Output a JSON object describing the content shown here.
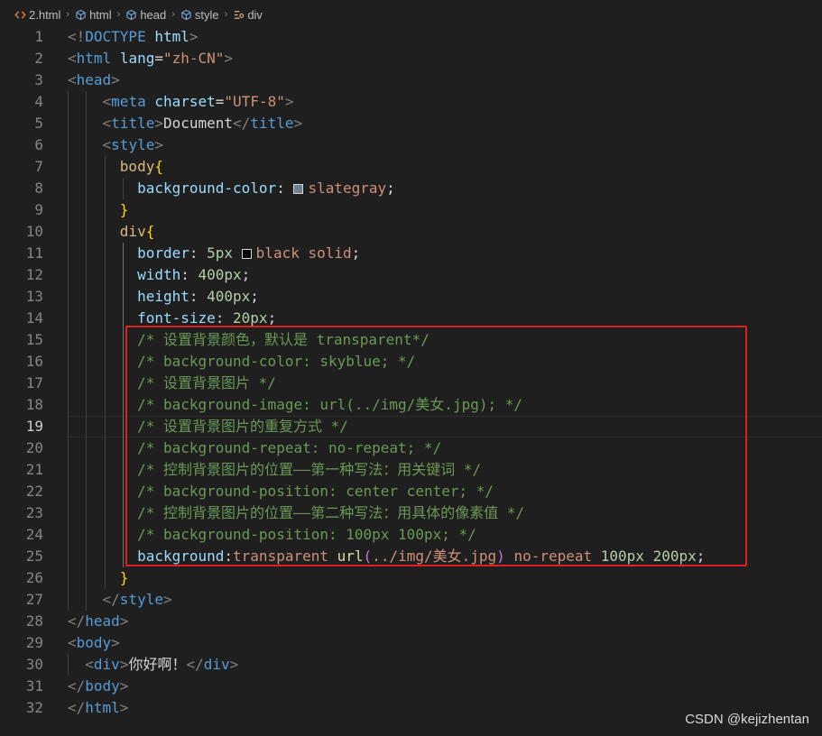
{
  "breadcrumb": {
    "items": [
      {
        "label": "2.html",
        "icon": "html-file-icon"
      },
      {
        "label": "html",
        "icon": "element-icon"
      },
      {
        "label": "head",
        "icon": "element-icon"
      },
      {
        "label": "style",
        "icon": "element-icon"
      },
      {
        "label": "div",
        "icon": "selector-icon"
      }
    ],
    "separator": "›"
  },
  "colors": {
    "swatch_slategray": "#708090",
    "swatch_black": "#000000",
    "highlight_box": "#e02020"
  },
  "active_line": 19,
  "watermark": "CSDN @kejizhentan",
  "lines": [
    {
      "n": 1,
      "tokens": [
        [
          "t-bracket",
          "<!"
        ],
        [
          "t-tag",
          "DOCTYPE"
        ],
        [
          "t-text",
          " "
        ],
        [
          "t-attr",
          "html"
        ],
        [
          "t-bracket",
          ">"
        ]
      ]
    },
    {
      "n": 2,
      "tokens": [
        [
          "t-bracket",
          "<"
        ],
        [
          "t-tag",
          "html"
        ],
        [
          "t-text",
          " "
        ],
        [
          "t-attr",
          "lang"
        ],
        [
          "t-text",
          "="
        ],
        [
          "t-str",
          "\"zh-CN\""
        ],
        [
          "t-bracket",
          ">"
        ]
      ]
    },
    {
      "n": 3,
      "tokens": [
        [
          "t-bracket",
          "<"
        ],
        [
          "t-tag",
          "head"
        ],
        [
          "t-bracket",
          ">"
        ]
      ]
    },
    {
      "n": 4,
      "tokens": [
        [
          "t-text",
          "    "
        ],
        [
          "t-bracket",
          "<"
        ],
        [
          "t-tag",
          "meta"
        ],
        [
          "t-text",
          " "
        ],
        [
          "t-attr",
          "charset"
        ],
        [
          "t-text",
          "="
        ],
        [
          "t-str",
          "\"UTF-8\""
        ],
        [
          "t-bracket",
          ">"
        ]
      ]
    },
    {
      "n": 5,
      "tokens": [
        [
          "t-text",
          "    "
        ],
        [
          "t-bracket",
          "<"
        ],
        [
          "t-tag",
          "title"
        ],
        [
          "t-bracket",
          ">"
        ],
        [
          "t-text",
          "Document"
        ],
        [
          "t-bracket",
          "</"
        ],
        [
          "t-tag",
          "title"
        ],
        [
          "t-bracket",
          ">"
        ]
      ]
    },
    {
      "n": 6,
      "tokens": [
        [
          "t-text",
          "    "
        ],
        [
          "t-bracket",
          "<"
        ],
        [
          "t-tag",
          "style"
        ],
        [
          "t-bracket",
          ">"
        ]
      ]
    },
    {
      "n": 7,
      "tokens": [
        [
          "t-text",
          "      "
        ],
        [
          "t-sel",
          "body"
        ],
        [
          "t-brace",
          "{"
        ]
      ]
    },
    {
      "n": 8,
      "tokens": [
        [
          "t-text",
          "        "
        ],
        [
          "t-prop",
          "background-color"
        ],
        [
          "t-text",
          ": "
        ],
        [
          "swatch",
          "slategray"
        ],
        [
          "t-val",
          "slategray"
        ],
        [
          "t-text",
          ";"
        ]
      ]
    },
    {
      "n": 9,
      "tokens": [
        [
          "t-text",
          "      "
        ],
        [
          "t-brace",
          "}"
        ]
      ]
    },
    {
      "n": 10,
      "tokens": [
        [
          "t-text",
          "      "
        ],
        [
          "t-sel",
          "div"
        ],
        [
          "t-brace",
          "{"
        ]
      ]
    },
    {
      "n": 11,
      "tokens": [
        [
          "t-text",
          "        "
        ],
        [
          "t-prop",
          "border"
        ],
        [
          "t-text",
          ": "
        ],
        [
          "t-num",
          "5px"
        ],
        [
          "t-text",
          " "
        ],
        [
          "swatch",
          "black"
        ],
        [
          "t-val",
          "black solid"
        ],
        [
          "t-text",
          ";"
        ]
      ]
    },
    {
      "n": 12,
      "tokens": [
        [
          "t-text",
          "        "
        ],
        [
          "t-prop",
          "width"
        ],
        [
          "t-text",
          ": "
        ],
        [
          "t-num",
          "400px"
        ],
        [
          "t-text",
          ";"
        ]
      ]
    },
    {
      "n": 13,
      "tokens": [
        [
          "t-text",
          "        "
        ],
        [
          "t-prop",
          "height"
        ],
        [
          "t-text",
          ": "
        ],
        [
          "t-num",
          "400px"
        ],
        [
          "t-text",
          ";"
        ]
      ]
    },
    {
      "n": 14,
      "tokens": [
        [
          "t-text",
          "        "
        ],
        [
          "t-prop",
          "font-size"
        ],
        [
          "t-text",
          ": "
        ],
        [
          "t-num",
          "20px"
        ],
        [
          "t-text",
          ";"
        ]
      ]
    },
    {
      "n": 15,
      "tokens": [
        [
          "t-text",
          "        "
        ],
        [
          "t-com",
          "/* 设置背景颜色，默认是 transparent*/"
        ]
      ]
    },
    {
      "n": 16,
      "tokens": [
        [
          "t-text",
          "        "
        ],
        [
          "t-com",
          "/* background-color: skyblue; */"
        ]
      ]
    },
    {
      "n": 17,
      "tokens": [
        [
          "t-text",
          "        "
        ],
        [
          "t-com",
          "/* 设置背景图片 */"
        ]
      ]
    },
    {
      "n": 18,
      "tokens": [
        [
          "t-text",
          "        "
        ],
        [
          "t-com",
          "/* background-image: url(../img/美女.jpg); */"
        ]
      ]
    },
    {
      "n": 19,
      "tokens": [
        [
          "t-text",
          "        "
        ],
        [
          "t-com",
          "/* 设置背景图片的重复方式 */"
        ]
      ]
    },
    {
      "n": 20,
      "tokens": [
        [
          "t-text",
          "        "
        ],
        [
          "t-com",
          "/* background-repeat: no-repeat; */"
        ]
      ]
    },
    {
      "n": 21,
      "tokens": [
        [
          "t-text",
          "        "
        ],
        [
          "t-com",
          "/* 控制背景图片的位置——第一种写法：用关键词 */"
        ]
      ]
    },
    {
      "n": 22,
      "tokens": [
        [
          "t-text",
          "        "
        ],
        [
          "t-com",
          "/* background-position: center center; */"
        ]
      ]
    },
    {
      "n": 23,
      "tokens": [
        [
          "t-text",
          "        "
        ],
        [
          "t-com",
          "/* 控制背景图片的位置——第二种写法：用具体的像素值 */"
        ]
      ]
    },
    {
      "n": 24,
      "tokens": [
        [
          "t-text",
          "        "
        ],
        [
          "t-com",
          "/* background-position: 100px 100px; */"
        ]
      ]
    },
    {
      "n": 25,
      "tokens": [
        [
          "t-text",
          "        "
        ],
        [
          "t-prop",
          "background"
        ],
        [
          "t-text",
          ":"
        ],
        [
          "t-val",
          "transparent"
        ],
        [
          "t-text",
          " "
        ],
        [
          "t-fn",
          "url"
        ],
        [
          "t-paren",
          "("
        ],
        [
          "t-val",
          "../img/美女.jpg"
        ],
        [
          "t-paren",
          ")"
        ],
        [
          "t-text",
          " "
        ],
        [
          "t-val",
          "no-repeat"
        ],
        [
          "t-text",
          " "
        ],
        [
          "t-num",
          "100px"
        ],
        [
          "t-text",
          " "
        ],
        [
          "t-num",
          "200px"
        ],
        [
          "t-text",
          ";"
        ]
      ]
    },
    {
      "n": 26,
      "tokens": [
        [
          "t-text",
          "      "
        ],
        [
          "t-brace",
          "}"
        ]
      ]
    },
    {
      "n": 27,
      "tokens": [
        [
          "t-text",
          "    "
        ],
        [
          "t-bracket",
          "</"
        ],
        [
          "t-tag",
          "style"
        ],
        [
          "t-bracket",
          ">"
        ]
      ]
    },
    {
      "n": 28,
      "tokens": [
        [
          "t-bracket",
          "</"
        ],
        [
          "t-tag",
          "head"
        ],
        [
          "t-bracket",
          ">"
        ]
      ]
    },
    {
      "n": 29,
      "tokens": [
        [
          "t-bracket",
          "<"
        ],
        [
          "t-tag",
          "body"
        ],
        [
          "t-bracket",
          ">"
        ]
      ]
    },
    {
      "n": 30,
      "tokens": [
        [
          "t-text",
          "  "
        ],
        [
          "t-bracket",
          "<"
        ],
        [
          "t-tag",
          "div"
        ],
        [
          "t-bracket",
          ">"
        ],
        [
          "t-text",
          "你好啊！"
        ],
        [
          "t-bracket",
          "</"
        ],
        [
          "t-tag",
          "div"
        ],
        [
          "t-bracket",
          ">"
        ]
      ]
    },
    {
      "n": 31,
      "tokens": [
        [
          "t-bracket",
          "</"
        ],
        [
          "t-tag",
          "body"
        ],
        [
          "t-bracket",
          ">"
        ]
      ]
    },
    {
      "n": 32,
      "tokens": [
        [
          "t-bracket",
          "</"
        ],
        [
          "t-tag",
          "html"
        ],
        [
          "t-bracket",
          ">"
        ]
      ]
    }
  ]
}
